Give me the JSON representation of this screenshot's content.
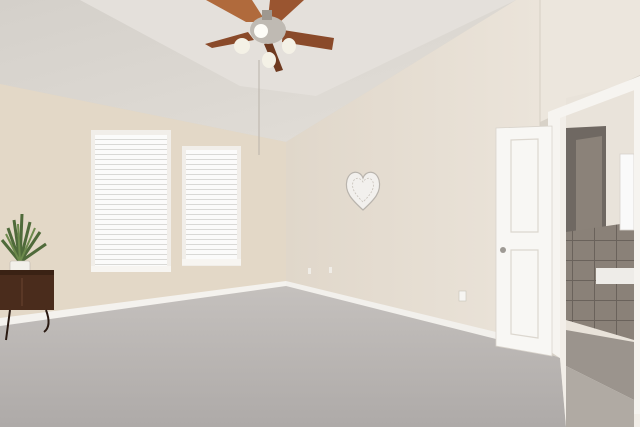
{
  "scene": {
    "kind": "photo-interior",
    "room": "empty bedroom",
    "elements": [
      "vaulted-ceiling",
      "ceiling-fan",
      "two-windows-with-blinds",
      "heart-wall-decor",
      "potted-plant",
      "wooden-chest",
      "open-door",
      "ensuite-bathroom",
      "carpet-floor"
    ]
  },
  "colors": {
    "ceiling": "#dcd8d2",
    "ceiling_shadow": "#cfc9c1",
    "wall_left": "#e2d7c6",
    "wall_center": "#e6ddd0",
    "wall_right": "#ebe5dc",
    "carpet": "#b9b5b3",
    "trim": "#f4f2ee",
    "fan_blade": "#8a4a2a",
    "door": "#f7f6f3",
    "bath_tile": "#7f7770"
  }
}
